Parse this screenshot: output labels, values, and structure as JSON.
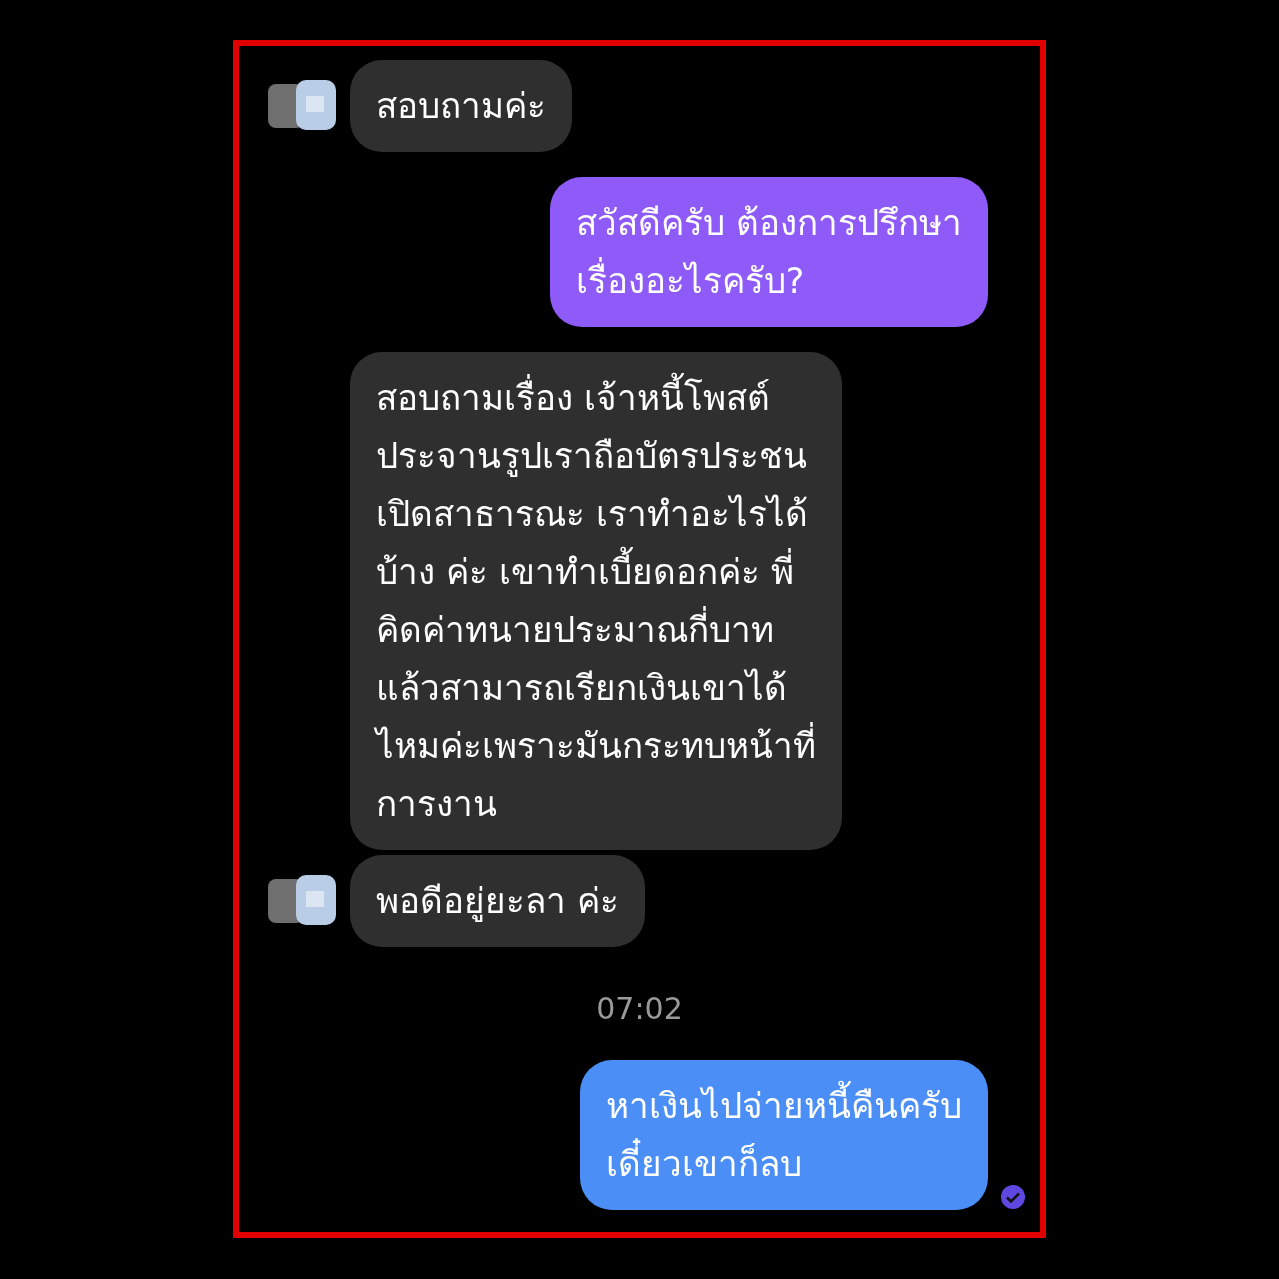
{
  "messages": [
    {
      "kind": "incoming",
      "avatar": true,
      "color": "#2f2f2f",
      "lines": [
        "สอบถามค่ะ"
      ]
    },
    {
      "kind": "outgoing",
      "avatar": false,
      "color": "#8f5bf8",
      "lines": [
        "สวัสดีครับ ต้องการปรึกษา",
        "เรื่องอะไรครับ?"
      ]
    },
    {
      "kind": "incoming",
      "avatar": false,
      "color": "#2f2f2f",
      "lines": [
        "สอบถามเรื่อง เจ้าหนี้โพสต์",
        "ประจานรูปเราถือบัตรประชน",
        "เปิดสาธารณะ เราทำอะไรได้",
        "บ้าง ค่ะ เขาทำเบี้ยดอกค่ะ พี่",
        "คิดค่าทนายประมาณกี่บาท",
        "แล้วสามารถเรียกเงินเขาได้",
        "ไหมค่ะเพราะมันกระทบหน้าที่",
        "การงาน"
      ]
    },
    {
      "kind": "incoming",
      "avatar": true,
      "color": "#2f2f2f",
      "lines": [
        "พอดีอยู่ยะลา ค่ะ"
      ]
    },
    {
      "kind": "time",
      "text": "07:02"
    },
    {
      "kind": "outgoing",
      "avatar": false,
      "color": "#4b8ef6",
      "read": true,
      "lines": [
        "หาเงินไปจ่ายหนี้คืนครับ",
        "เดี๋ยวเขาก็ลบ"
      ]
    }
  ]
}
